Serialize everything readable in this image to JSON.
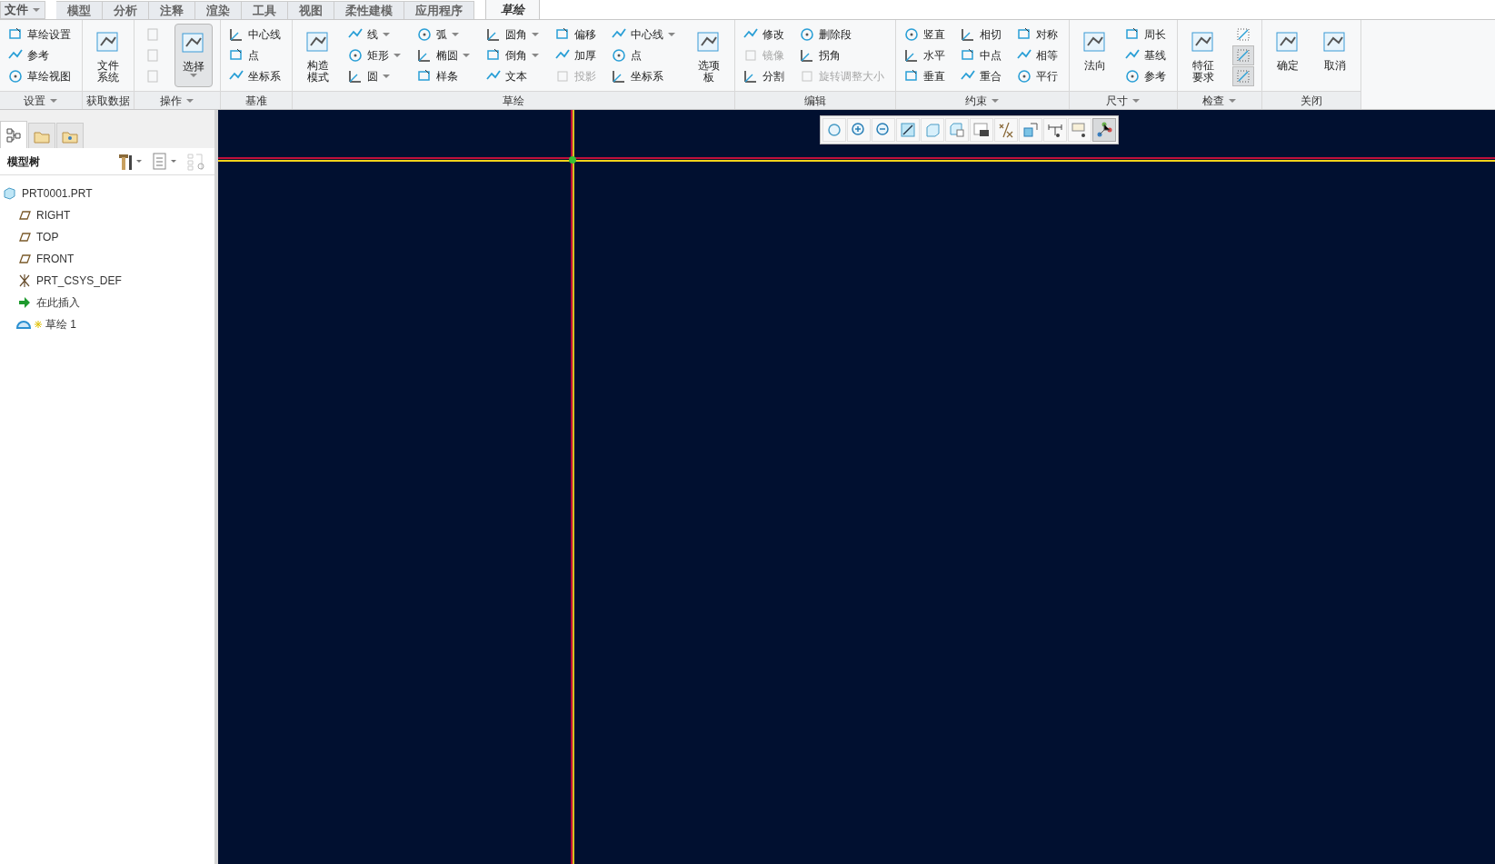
{
  "file_menu": {
    "label": "文件",
    "dropdown": true
  },
  "tabs": [
    {
      "label": "模型",
      "selected": false
    },
    {
      "label": "分析",
      "selected": false
    },
    {
      "label": "注释",
      "selected": false
    },
    {
      "label": "渲染",
      "selected": false
    },
    {
      "label": "工具",
      "selected": false
    },
    {
      "label": "视图",
      "selected": false
    },
    {
      "label": "柔性建模",
      "selected": false
    },
    {
      "label": "应用程序",
      "selected": false
    },
    {
      "label": "草绘",
      "selected": true
    }
  ],
  "ribbon": [
    {
      "label": "设置",
      "dropdown": true,
      "columns": [
        {
          "kind": "stack",
          "items": [
            {
              "label": "草绘设置"
            },
            {
              "label": "参考"
            },
            {
              "label": "草绘视图"
            }
          ]
        }
      ]
    },
    {
      "label": "获取数据",
      "columns": [
        {
          "kind": "large",
          "label": "文件系统"
        }
      ]
    },
    {
      "label": "操作",
      "dropdown": true,
      "columns": [
        {
          "kind": "icons",
          "items": [
            {
              "disabled": true,
              "selected": false
            },
            {
              "disabled": true,
              "selected": false
            },
            {
              "disabled": true,
              "selected": false
            }
          ]
        },
        {
          "kind": "large",
          "label": "选择",
          "selected": true,
          "dropdown": true
        }
      ]
    },
    {
      "label": "基准",
      "columns": [
        {
          "kind": "stack",
          "items": [
            {
              "label": "中心线"
            },
            {
              "label": "点"
            },
            {
              "label": "坐标系"
            }
          ]
        }
      ]
    },
    {
      "label": "草绘",
      "columns": [
        {
          "kind": "large",
          "label": "构造模式"
        },
        {
          "kind": "stack",
          "items": [
            {
              "label": "线",
              "dropdown": true
            },
            {
              "label": "矩形",
              "dropdown": true
            },
            {
              "label": "圆",
              "dropdown": true
            }
          ]
        },
        {
          "kind": "stack",
          "items": [
            {
              "label": "弧",
              "dropdown": true
            },
            {
              "label": "椭圆",
              "dropdown": true
            },
            {
              "label": "样条"
            }
          ]
        },
        {
          "kind": "stack",
          "items": [
            {
              "label": "圆角",
              "dropdown": true
            },
            {
              "label": "倒角",
              "dropdown": true
            },
            {
              "label": "文本"
            }
          ]
        },
        {
          "kind": "stack",
          "items": [
            {
              "label": "偏移"
            },
            {
              "label": "加厚"
            },
            {
              "label": "投影",
              "disabled": true
            }
          ]
        },
        {
          "kind": "stack",
          "items": [
            {
              "label": "中心线",
              "dropdown": true
            },
            {
              "label": "点"
            },
            {
              "label": "坐标系"
            }
          ]
        },
        {
          "kind": "large",
          "label": "选项板"
        }
      ]
    },
    {
      "label": "编辑",
      "columns": [
        {
          "kind": "stack",
          "items": [
            {
              "label": "修改"
            },
            {
              "label": "镜像",
              "disabled": true
            },
            {
              "label": "分割"
            }
          ]
        },
        {
          "kind": "stack",
          "items": [
            {
              "label": "删除段"
            },
            {
              "label": "拐角"
            },
            {
              "label": "旋转调整大小",
              "disabled": true
            }
          ]
        }
      ]
    },
    {
      "label": "约束",
      "dropdown": true,
      "columns": [
        {
          "kind": "stack",
          "items": [
            {
              "label": "竖直"
            },
            {
              "label": "水平"
            },
            {
              "label": "垂直"
            }
          ]
        },
        {
          "kind": "stack",
          "items": [
            {
              "label": "相切"
            },
            {
              "label": "中点"
            },
            {
              "label": "重合"
            }
          ]
        },
        {
          "kind": "stack",
          "items": [
            {
              "label": "对称"
            },
            {
              "label": "相等"
            },
            {
              "label": "平行"
            }
          ]
        }
      ]
    },
    {
      "label": "尺寸",
      "dropdown": true,
      "columns": [
        {
          "kind": "large",
          "label": "法向"
        },
        {
          "kind": "stack",
          "items": [
            {
              "label": "周长"
            },
            {
              "label": "基线"
            },
            {
              "label": "参考"
            }
          ]
        }
      ]
    },
    {
      "label": "检查",
      "dropdown": true,
      "columns": [
        {
          "kind": "large",
          "label": "特征要求"
        },
        {
          "kind": "icons",
          "items": [
            {
              "disabled": false,
              "selected": false
            },
            {
              "disabled": false,
              "selected": true
            },
            {
              "disabled": false,
              "selected": true
            }
          ]
        }
      ]
    },
    {
      "label": "关闭",
      "columns": [
        {
          "kind": "large",
          "label": "确定"
        },
        {
          "kind": "large",
          "label": "取消"
        }
      ]
    }
  ],
  "panel": {
    "tabs": [
      {
        "selected": true
      },
      {
        "selected": false
      },
      {
        "selected": false
      }
    ],
    "title": "模型树"
  },
  "tree": [
    {
      "label": "PRT0001.PRT",
      "kind": "part",
      "children": [
        {
          "label": "RIGHT",
          "kind": "plane"
        },
        {
          "label": "TOP",
          "kind": "plane"
        },
        {
          "label": "FRONT",
          "kind": "plane"
        },
        {
          "label": "PRT_CSYS_DEF",
          "kind": "csys"
        },
        {
          "label": "在此插入",
          "kind": "insert"
        },
        {
          "label": "草绘 1",
          "kind": "sketch"
        }
      ]
    }
  ],
  "view_toolbar": [
    {
      "selected": false
    },
    {
      "selected": false
    },
    {
      "selected": false
    },
    {
      "selected": false
    },
    {
      "selected": false
    },
    {
      "selected": false
    },
    {
      "selected": false
    },
    {
      "selected": false
    },
    {
      "selected": false
    },
    {
      "selected": false
    },
    {
      "selected": false
    },
    {
      "selected": true
    }
  ]
}
